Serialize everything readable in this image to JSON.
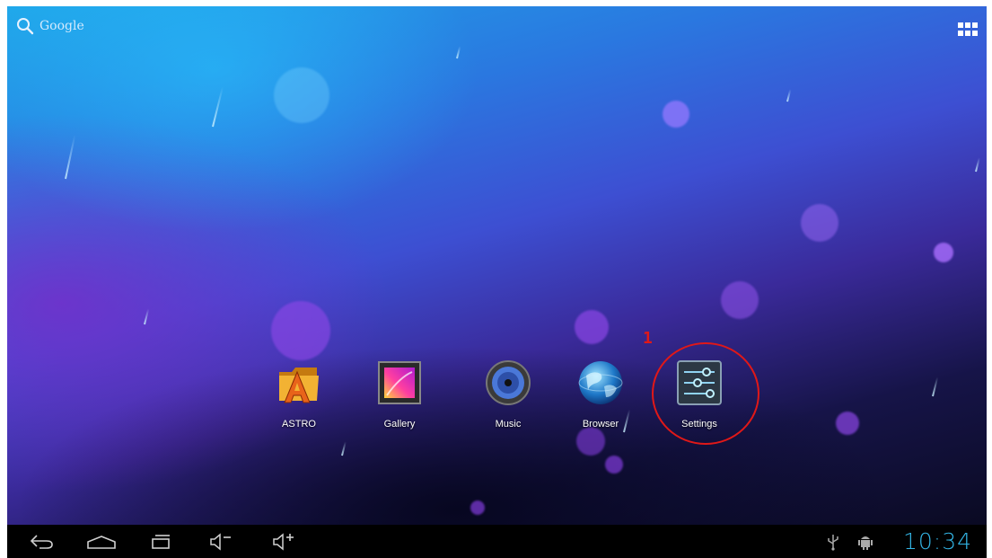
{
  "search": {
    "label": "Google",
    "icon": "search-icon"
  },
  "apps_button": {
    "icon": "all-apps-grid-icon"
  },
  "apps": [
    {
      "label": "ASTRO",
      "icon": "astro-folder-icon"
    },
    {
      "label": "Gallery",
      "icon": "gallery-icon"
    },
    {
      "label": "Music",
      "icon": "music-speaker-icon"
    },
    {
      "label": "Browser",
      "icon": "globe-icon"
    },
    {
      "label": "Settings",
      "icon": "settings-sliders-icon"
    }
  ],
  "annotation": {
    "number": "1",
    "color": "#e01818"
  },
  "navbar": {
    "buttons": [
      "back-icon",
      "home-icon",
      "recent-apps-icon",
      "volume-down-icon",
      "volume-up-icon"
    ],
    "status_icons": [
      "usb-icon",
      "android-debug-icon"
    ],
    "clock": "10:34",
    "clock_color": "#33b5e5"
  }
}
